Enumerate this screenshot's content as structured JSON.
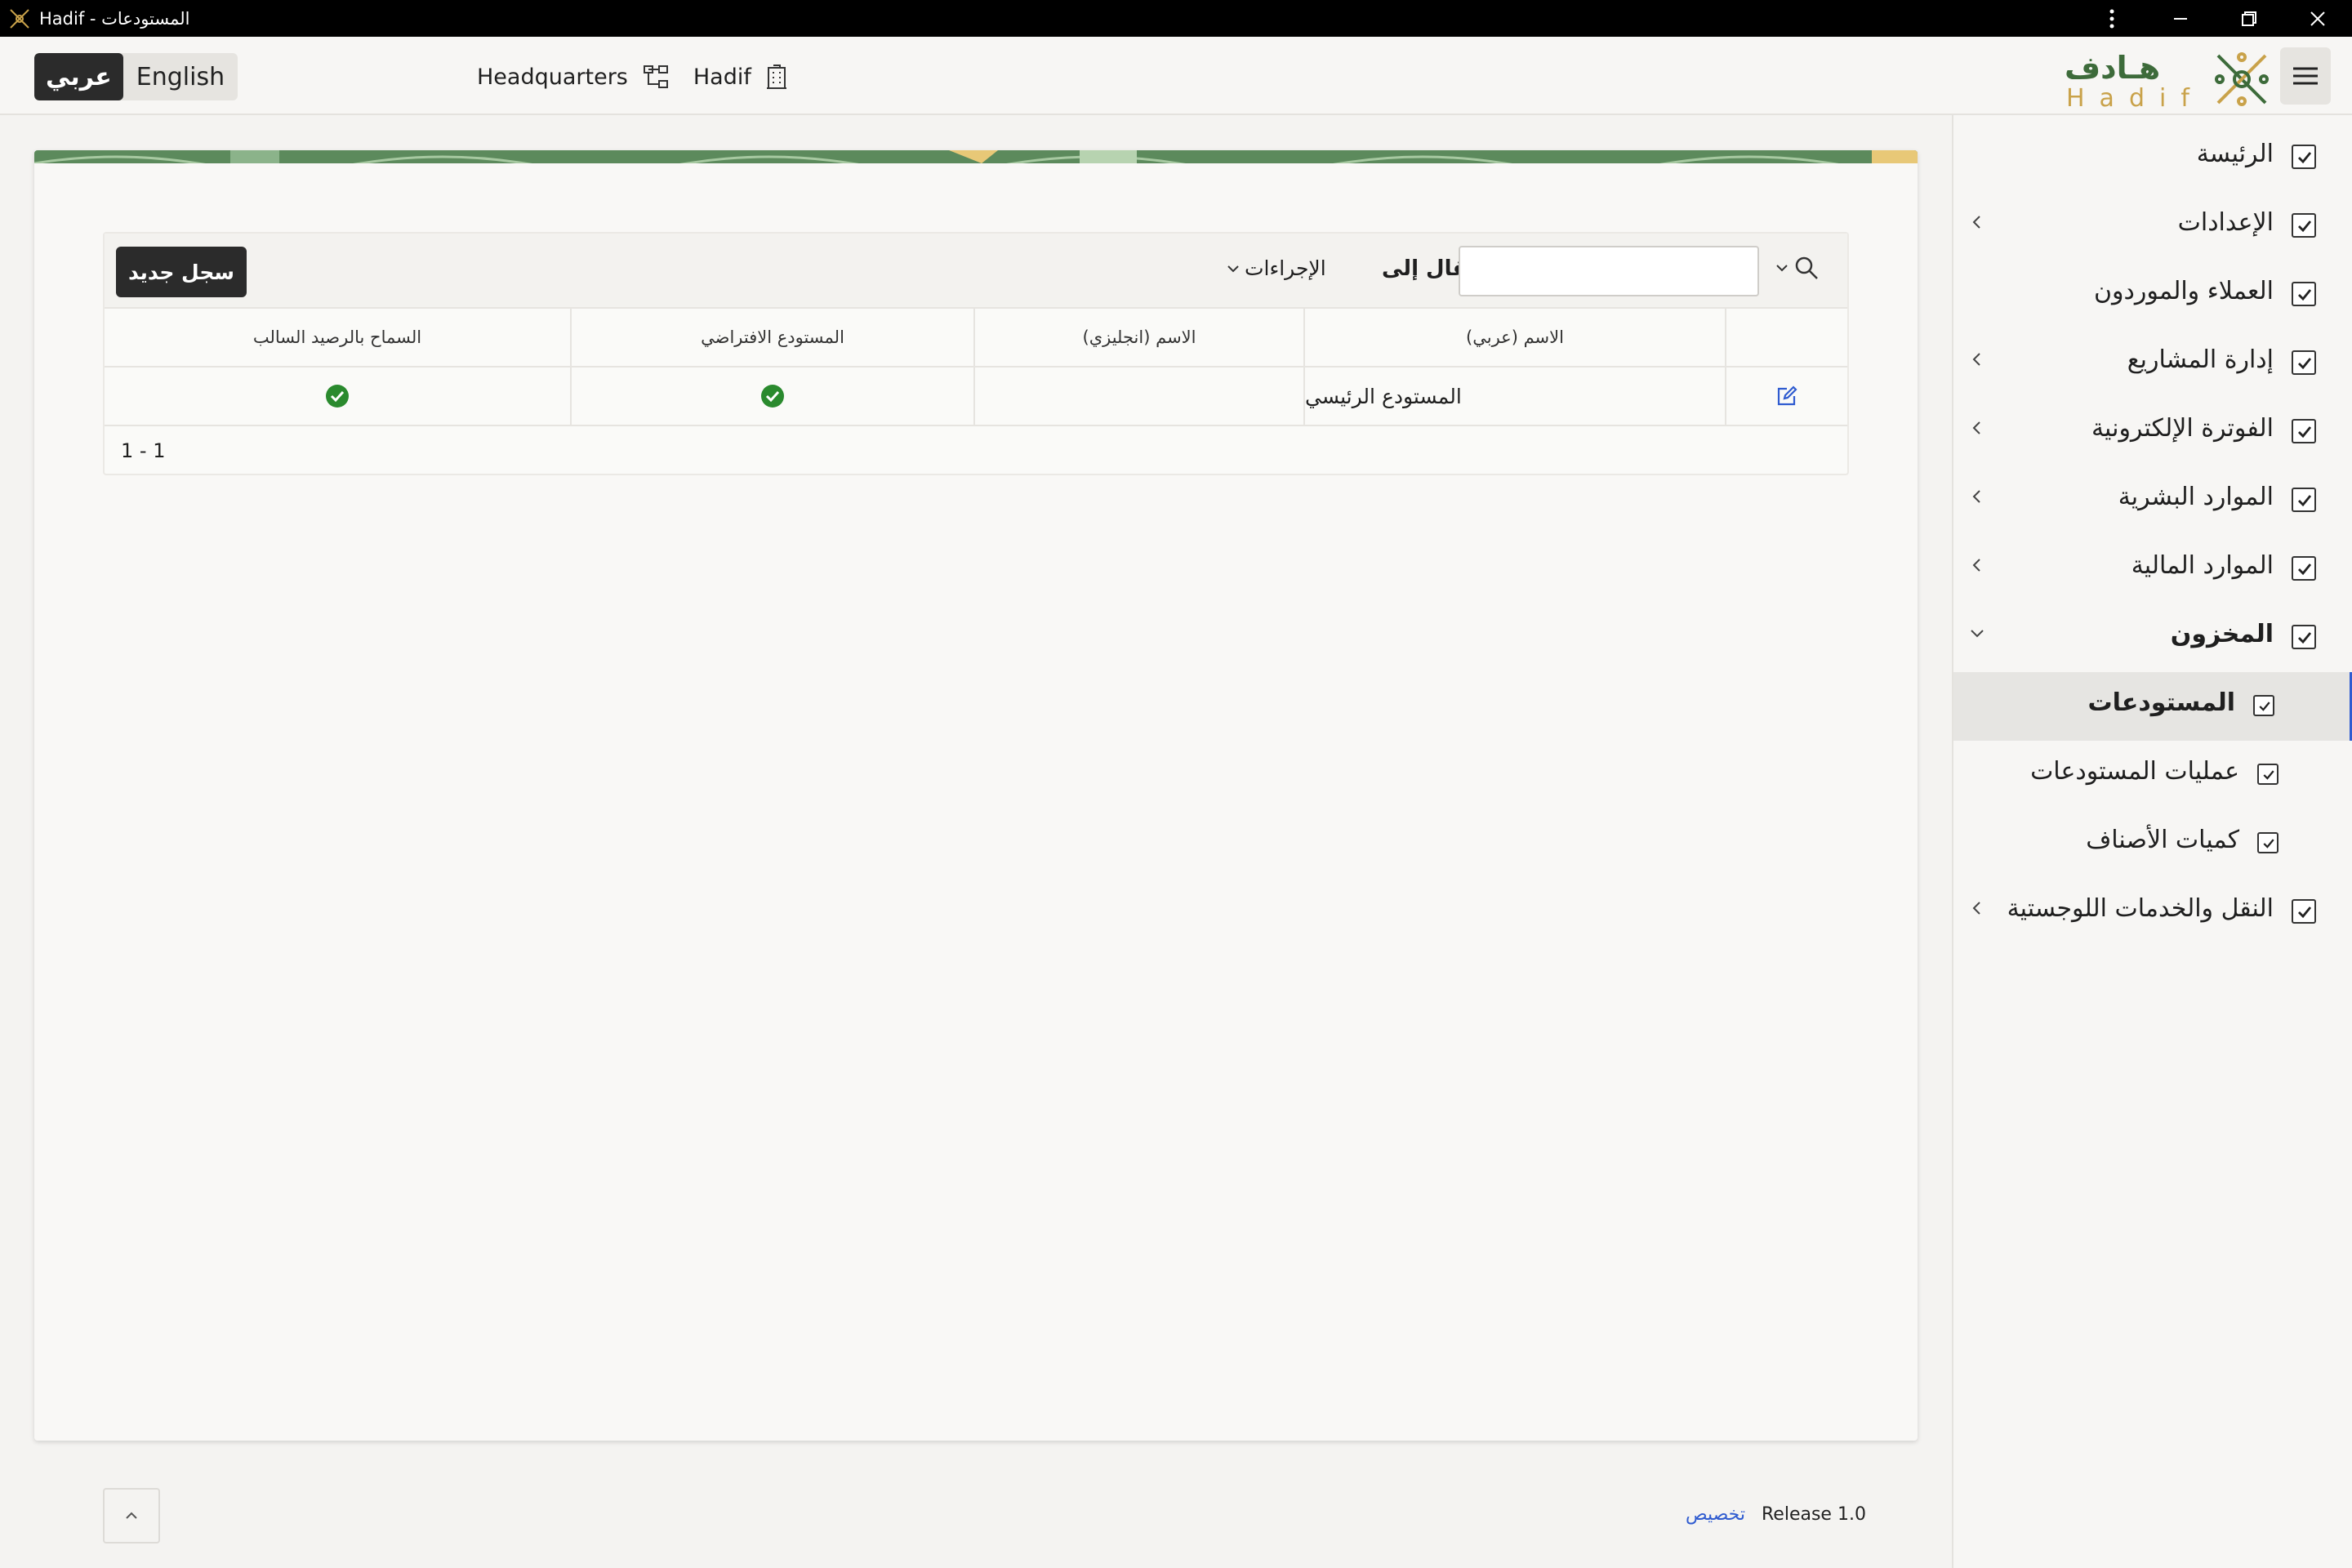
{
  "window": {
    "title": "Hadif - المستودعات",
    "controls": [
      "more-icon",
      "minimize-icon",
      "maximize-icon",
      "close-icon"
    ]
  },
  "header": {
    "languages": {
      "arabic": "عربي",
      "english": "English"
    },
    "breadcrumbs": [
      {
        "label": "Headquarters",
        "icon": "org-chart-icon"
      },
      {
        "label": "Hadif",
        "icon": "building-icon"
      }
    ],
    "logo": {
      "arabic": "هـادف",
      "latin": "Hadif"
    }
  },
  "sidebar": {
    "items": [
      {
        "label": "الرئيسة",
        "expandable": false
      },
      {
        "label": "الإعدادات",
        "expandable": true
      },
      {
        "label": "العملاء والموردون",
        "expandable": false
      },
      {
        "label": "إدارة المشاريع",
        "expandable": true
      },
      {
        "label": "الفوترة الإلكترونية",
        "expandable": true
      },
      {
        "label": "الموارد البشرية",
        "expandable": true
      },
      {
        "label": "الموارد المالية",
        "expandable": true
      },
      {
        "label": "المخزون",
        "expandable": true,
        "expanded": true
      },
      {
        "label": "المستودعات",
        "sub": true,
        "selected": true
      },
      {
        "label": "عمليات المستودعات",
        "sub": true
      },
      {
        "label": "كميات الأصناف",
        "sub": true
      },
      {
        "label": "النقل والخدمات اللوجستية",
        "expandable": true
      }
    ]
  },
  "toolbar": {
    "new_record": "سجل جديد",
    "actions": "الإجراءات",
    "goto": "انتقال إلى",
    "search_value": ""
  },
  "table": {
    "columns": [
      "الاسم (عربي)",
      "الاسم (انجليزي)",
      "المستودع الافتراضي",
      "السماح بالرصيد السالب"
    ],
    "rows": [
      {
        "name_ar": "المستودع الرئيسي",
        "name_en": "",
        "default_warehouse": true,
        "allow_negative": true
      }
    ],
    "pagination": "1 - 1"
  },
  "footer": {
    "customize": "تخصيص",
    "release": "Release 1.0"
  },
  "colors": {
    "accent": "#2f5bd0",
    "check_green": "#2a8a2e",
    "logo_gold": "#c9a24a",
    "logo_green": "#3d6b3a"
  }
}
